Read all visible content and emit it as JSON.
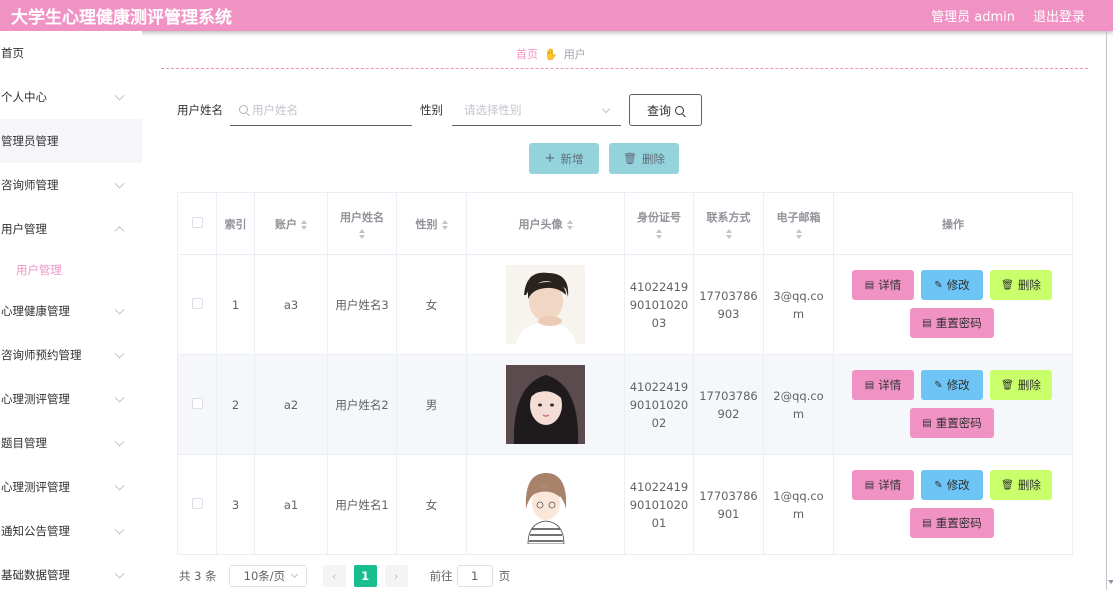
{
  "header": {
    "title": "大学生心理健康测评管理系统",
    "admin_label": "管理员 admin",
    "logout_label": "退出登录"
  },
  "sidebar": {
    "items": [
      {
        "label": "首页",
        "chevron": false,
        "open": false
      },
      {
        "label": "个人中心",
        "chevron": true,
        "open": false
      },
      {
        "label": "管理员管理",
        "chevron": false,
        "open": false
      },
      {
        "label": "咨询师管理",
        "chevron": true,
        "open": false
      },
      {
        "label": "用户管理",
        "chevron": true,
        "open": true
      },
      {
        "label": "心理健康管理",
        "chevron": true,
        "open": false
      },
      {
        "label": "咨询师预约管理",
        "chevron": true,
        "open": false
      },
      {
        "label": "心理测评管理",
        "chevron": true,
        "open": false
      },
      {
        "label": "题目管理",
        "chevron": true,
        "open": false
      },
      {
        "label": "心理测评管理",
        "chevron": true,
        "open": false
      },
      {
        "label": "通知公告管理",
        "chevron": true,
        "open": false
      },
      {
        "label": "基础数据管理",
        "chevron": true,
        "open": false
      }
    ],
    "submenu_active": "用户管理"
  },
  "breadcrumb": {
    "home": "首页",
    "current": "用户"
  },
  "search": {
    "name_label": "用户姓名",
    "name_placeholder": "用户姓名",
    "gender_label": "性别",
    "gender_placeholder": "请选择性别",
    "query_label": "查询"
  },
  "toolbar": {
    "add_label": "新增",
    "delete_label": "删除"
  },
  "table": {
    "headers": {
      "index": "索引",
      "account": "账户",
      "name": "用户姓名",
      "gender": "性别",
      "avatar": "用户头像",
      "id_card": "身份证号",
      "phone": "联系方式",
      "email": "电子邮箱",
      "ops": "操作"
    },
    "rows": [
      {
        "index": "1",
        "account": "a3",
        "name": "用户姓名3",
        "gender": "女",
        "id_card": "410224199010102003",
        "phone": "17703786903",
        "email": "3@qq.com"
      },
      {
        "index": "2",
        "account": "a2",
        "name": "用户姓名2",
        "gender": "男",
        "id_card": "410224199010102002",
        "phone": "17703786902",
        "email": "2@qq.com"
      },
      {
        "index": "3",
        "account": "a1",
        "name": "用户姓名1",
        "gender": "女",
        "id_card": "410224199010102001",
        "phone": "17703786901",
        "email": "1@qq.com"
      }
    ],
    "op_labels": {
      "detail": "详情",
      "edit": "修改",
      "delete": "删除",
      "reset": "重置密码"
    }
  },
  "pagination": {
    "total": "共 3 条",
    "page_size": "10条/页",
    "current_page": "1",
    "goto_prefix": "前往",
    "goto_value": "1",
    "goto_suffix": "页"
  },
  "colors": {
    "brand": "#f093c4",
    "teal_button": "#95d3dc",
    "edit": "#6dc4f5",
    "delete": "#c8ff6a",
    "pager_active": "#19be8f"
  }
}
